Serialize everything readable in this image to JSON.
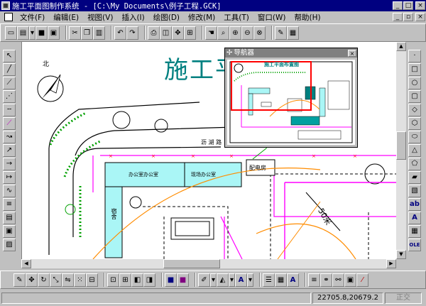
{
  "window": {
    "title": "施工平面图制作系统 - [C:\\My Documents\\例子工程.GCK]",
    "minimize": "_",
    "maximize": "□",
    "close": "×"
  },
  "menu": {
    "items": [
      "文件(F)",
      "编辑(E)",
      "视图(V)",
      "插入(I)",
      "绘图(D)",
      "修改(M)",
      "工具(T)",
      "窗口(W)",
      "帮助(H)"
    ],
    "doc_minimize": "_",
    "doc_restore": "▫",
    "doc_close": "×"
  },
  "drawing": {
    "title": "施工平",
    "north_label": "北",
    "road_label": "沥 湖 路",
    "office1": "办公室办公室",
    "office2": "现场办公室",
    "power_room": "配电房",
    "dorm": "宿舍",
    "crane_radius": "50米"
  },
  "navigator": {
    "title": "导航器",
    "close": "×",
    "mini_title": "施工平面布置图"
  },
  "status": {
    "coords": "22705.8,20679.2",
    "mode": "正交"
  },
  "colors": {
    "title_bar": "#000080",
    "site_fence": "#ff00ff",
    "building_fill": "#aaf6f6",
    "crane_arc": "#ff8c00",
    "viewport_frame": "#ff0000",
    "label_text": "#008080"
  }
}
